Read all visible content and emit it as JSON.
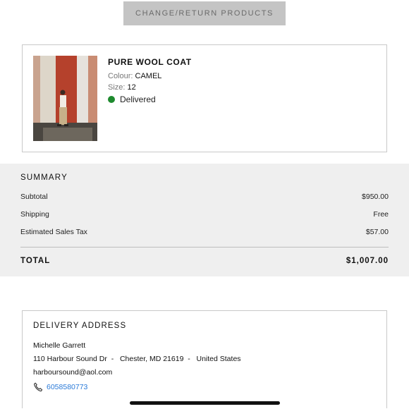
{
  "top": {
    "change_return_label": "CHANGE/RETURN PRODUCTS"
  },
  "product": {
    "name": "PURE WOOL COAT",
    "colour_label": "Colour:",
    "colour_value": "CAMEL",
    "size_label": "Size:",
    "size_value": "12",
    "status": "Delivered",
    "status_color": "#1e8a2e"
  },
  "summary": {
    "title": "SUMMARY",
    "rows": [
      {
        "label": "Subtotal",
        "value": "$950.00"
      },
      {
        "label": "Shipping",
        "value": "Free"
      },
      {
        "label": "Estimated Sales Tax",
        "value": "$57.00"
      }
    ],
    "total_label": "TOTAL",
    "total_value": "$1,007.00"
  },
  "delivery": {
    "title": "DELIVERY ADDRESS",
    "name": "Michelle Garrett",
    "street": "110 Harbour Sound Dr  -   Chester, MD 21619  -   United States",
    "email": "harboursound@aol.com",
    "phone": "6058580773",
    "phone_icon": "phone-icon",
    "link_color": "#2a7ad8"
  }
}
